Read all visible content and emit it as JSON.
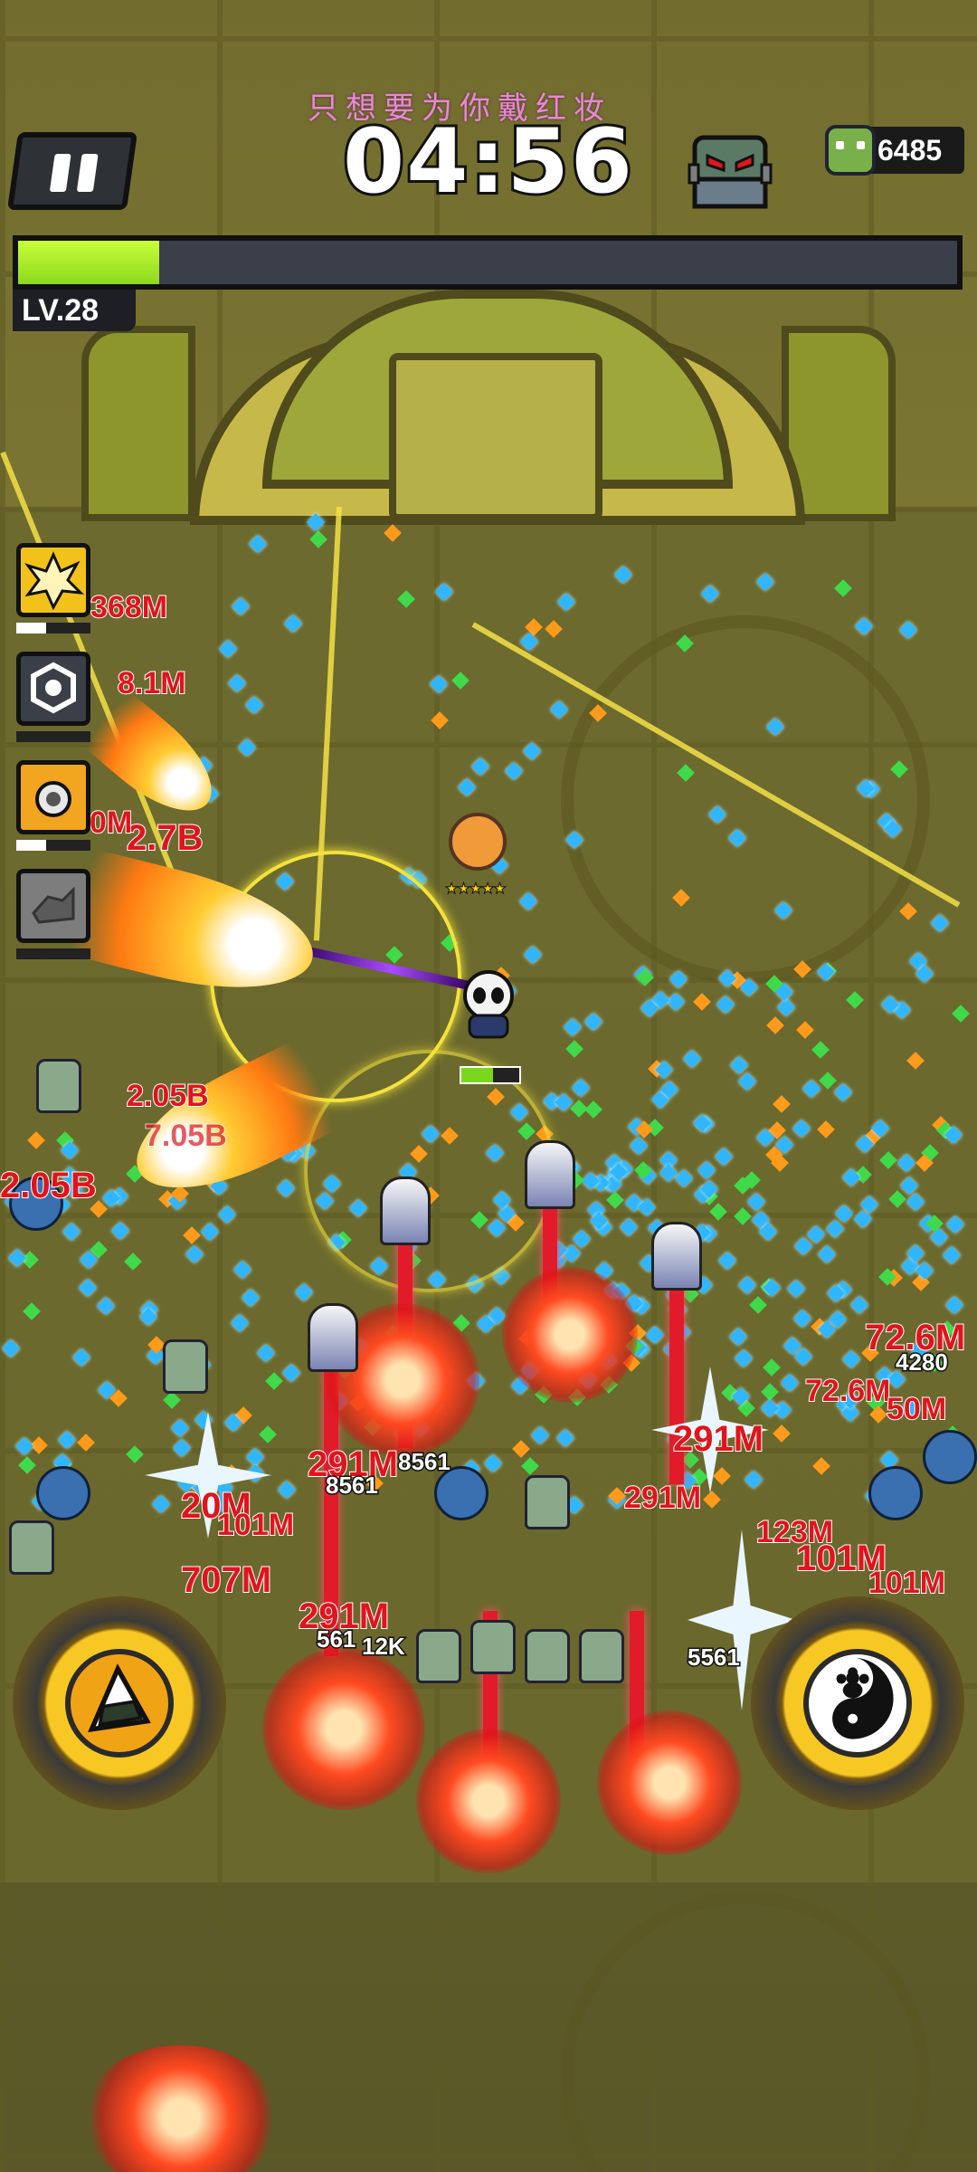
{
  "hud": {
    "song_title": "只想要为你戴红妆",
    "timer": "04:56",
    "kill_count": "6485",
    "level_label": "LV.28",
    "xp_progress": 0.15
  },
  "player": {
    "hp_fraction": 0.55,
    "pet_stars": "★★★★★"
  },
  "skills": [
    {
      "name": "explosion-skill-icon",
      "color": "#f2c21a",
      "cooldown": 0.4
    },
    {
      "name": "hexagon-shield-skill-icon",
      "color": "#3a3f48",
      "cooldown": 0.0
    },
    {
      "name": "bomb-skill-icon",
      "color": "#f2a51e",
      "cooldown": 0.4
    },
    {
      "name": "drone-skill-icon",
      "color": "#7d7d7d",
      "cooldown": 0.0
    }
  ],
  "damage_numbers": [
    {
      "text": "2.7B",
      "style": "red"
    },
    {
      "text": "2.05B",
      "style": "red"
    },
    {
      "text": "7.05B",
      "style": "red"
    },
    {
      "text": "2.05B",
      "style": "red"
    },
    {
      "text": "368M",
      "style": "red"
    },
    {
      "text": "8.1M",
      "style": "red"
    },
    {
      "text": "50M",
      "style": "red"
    },
    {
      "text": "72.6M",
      "style": "red"
    },
    {
      "text": "4280",
      "style": "white"
    },
    {
      "text": "72.6M",
      "style": "red"
    },
    {
      "text": "50M",
      "style": "red"
    },
    {
      "text": "101M",
      "style": "red"
    },
    {
      "text": "291M",
      "style": "red"
    },
    {
      "text": "8561",
      "style": "white"
    },
    {
      "text": "291M",
      "style": "red"
    },
    {
      "text": "20M",
      "style": "red"
    },
    {
      "text": "101M",
      "style": "red"
    },
    {
      "text": "707M",
      "style": "red"
    },
    {
      "text": "291M",
      "style": "red"
    },
    {
      "text": "561",
      "style": "white"
    },
    {
      "text": "12K",
      "style": "white"
    },
    {
      "text": "123M",
      "style": "red"
    },
    {
      "text": "291M",
      "style": "red"
    },
    {
      "text": "101M",
      "style": "red"
    },
    {
      "text": "5561",
      "style": "white"
    },
    {
      "text": "8561",
      "style": "white"
    }
  ],
  "buttons": {
    "left_skill": "rice-ball-icon",
    "right_skill": "yin-yang-paw-icon"
  },
  "colors": {
    "xp": "#a6ef2a",
    "damage": "#e0141c",
    "gem": "#2fb6ff"
  }
}
